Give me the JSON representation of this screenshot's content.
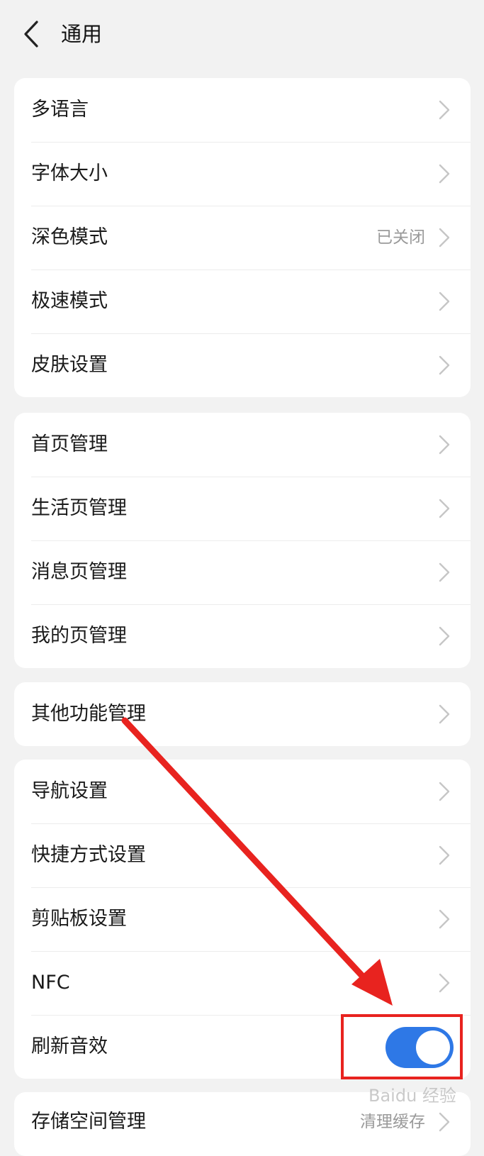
{
  "header": {
    "title": "通用"
  },
  "groups": [
    {
      "items": [
        {
          "label": "多语言"
        },
        {
          "label": "字体大小"
        },
        {
          "label": "深色模式",
          "value": "已关闭"
        },
        {
          "label": "极速模式"
        },
        {
          "label": "皮肤设置"
        }
      ]
    },
    {
      "items": [
        {
          "label": "首页管理"
        },
        {
          "label": "生活页管理"
        },
        {
          "label": "消息页管理"
        },
        {
          "label": "我的页管理"
        }
      ]
    },
    {
      "items": [
        {
          "label": "其他功能管理"
        }
      ]
    },
    {
      "items": [
        {
          "label": "导航设置"
        },
        {
          "label": "快捷方式设置"
        },
        {
          "label": "剪贴板设置"
        },
        {
          "label": "NFC"
        },
        {
          "label": "刷新音效",
          "toggle": true
        }
      ]
    },
    {
      "items": [
        {
          "label": "存储空间管理",
          "value": "清理缓存"
        }
      ]
    }
  ],
  "colors": {
    "accent": "#2e78e6",
    "annotation": "#e8231f",
    "background": "#f2f2f2"
  },
  "watermark": {
    "text": "Baidu 经验"
  }
}
